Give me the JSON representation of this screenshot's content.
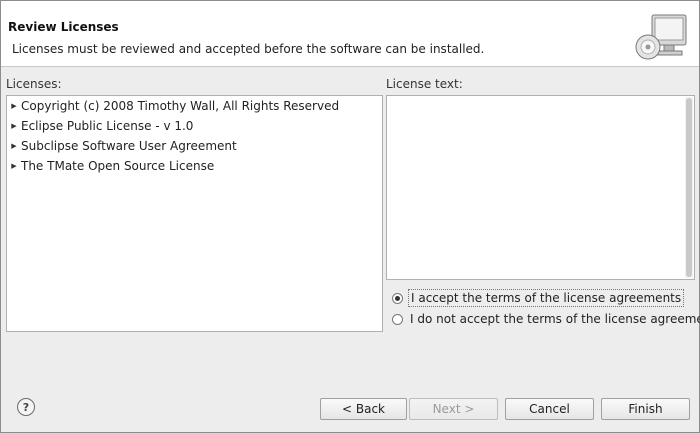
{
  "header": {
    "title": "Review Licenses",
    "description": "Licenses must be reviewed and accepted before the software can be installed."
  },
  "licenses": {
    "label": "Licenses:",
    "items": [
      {
        "label": "Copyright (c) 2008 Timothy Wall, All Rights Reserved"
      },
      {
        "label": "Eclipse Public License - v 1.0"
      },
      {
        "label": "Subclipse Software User Agreement"
      },
      {
        "label": "The TMate Open Source License"
      }
    ]
  },
  "license_text": {
    "label": "License text:",
    "content": ""
  },
  "acceptance": {
    "accept_label": "I accept the terms of the license agreements",
    "decline_label": "I do not accept the terms of the license agreements",
    "selected": "accept"
  },
  "buttons": {
    "back": "< Back",
    "next": "Next >",
    "cancel": "Cancel",
    "finish": "Finish",
    "help": "?"
  },
  "icons": {
    "expand": "triangle-right-icon",
    "wizard": "monitor-cd-icon",
    "help": "question-mark-icon"
  }
}
